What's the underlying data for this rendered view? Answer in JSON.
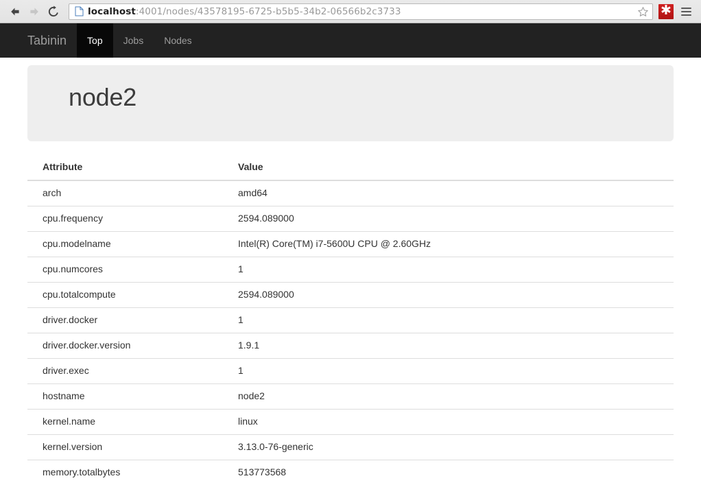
{
  "browser": {
    "back_label": "Back",
    "forward_label": "Forward",
    "reload_label": "Reload",
    "url_scheme_host": "localhost",
    "url_rest": ":4001/nodes/43578195-6725-b5b5-34b2-06566b2c3733",
    "url_full": "localhost:4001/nodes/43578195-6725-b5b5-34b2-06566b2c3733",
    "bookmark_label": "Bookmark this page",
    "extension_glyph": "✱",
    "extension_label": "LastPass",
    "extension_color": "#c11b1b",
    "menu_label": "Customize and control"
  },
  "navbar": {
    "brand": "Tabinin",
    "background_color": "#222222",
    "active_background_color": "#080808",
    "link_color": "#9d9d9d",
    "items": [
      {
        "label": "Top",
        "active": true
      },
      {
        "label": "Jobs",
        "active": false
      },
      {
        "label": "Nodes",
        "active": false
      }
    ]
  },
  "jumbotron": {
    "title": "node2",
    "background_color": "#eeeeee"
  },
  "table": {
    "columns": [
      "Attribute",
      "Value"
    ],
    "rows": [
      {
        "attribute": "arch",
        "value": "amd64"
      },
      {
        "attribute": "cpu.frequency",
        "value": "2594.089000"
      },
      {
        "attribute": "cpu.modelname",
        "value": "Intel(R) Core(TM) i7-5600U CPU @ 2.60GHz"
      },
      {
        "attribute": "cpu.numcores",
        "value": "1"
      },
      {
        "attribute": "cpu.totalcompute",
        "value": "2594.089000"
      },
      {
        "attribute": "driver.docker",
        "value": "1"
      },
      {
        "attribute": "driver.docker.version",
        "value": "1.9.1"
      },
      {
        "attribute": "driver.exec",
        "value": "1"
      },
      {
        "attribute": "hostname",
        "value": "node2"
      },
      {
        "attribute": "kernel.name",
        "value": "linux"
      },
      {
        "attribute": "kernel.version",
        "value": "3.13.0-76-generic"
      },
      {
        "attribute": "memory.totalbytes",
        "value": "513773568"
      }
    ]
  }
}
